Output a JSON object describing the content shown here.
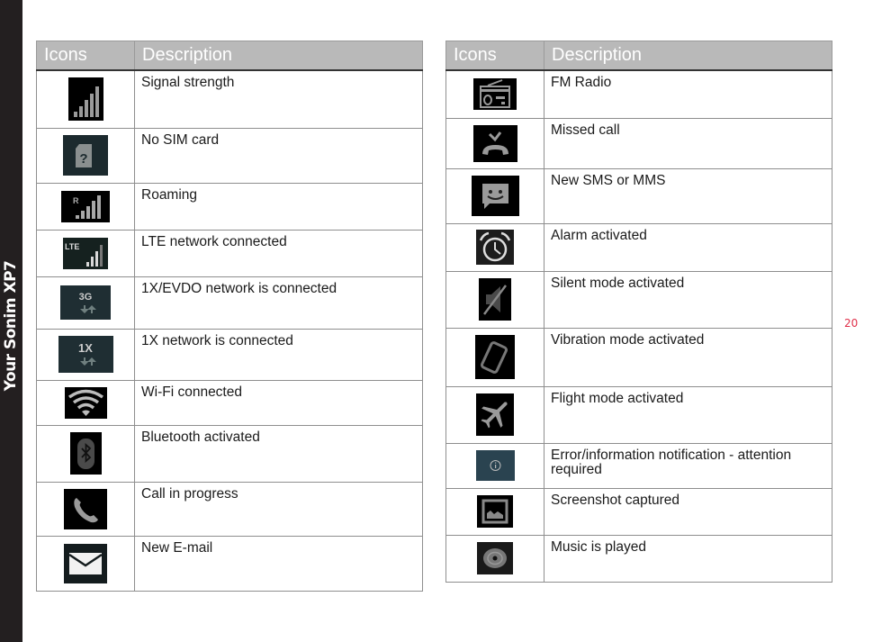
{
  "sidebar": {
    "title": "Your Sonim XP7"
  },
  "page_number": "20",
  "left_table": {
    "headers": {
      "icons": "Icons",
      "description": "Description"
    },
    "rows": [
      {
        "icon": "signal-strength-icon",
        "description": "Signal strength"
      },
      {
        "icon": "no-sim-card-icon",
        "description": "No SIM card"
      },
      {
        "icon": "roaming-icon",
        "description": "Roaming"
      },
      {
        "icon": "lte-icon",
        "description": "LTE network connected"
      },
      {
        "icon": "3g-icon",
        "description": "1X/EVDO network is connected"
      },
      {
        "icon": "1x-icon",
        "description": "1X network is connected"
      },
      {
        "icon": "wifi-icon",
        "description": "Wi-Fi connected"
      },
      {
        "icon": "bluetooth-icon",
        "description": "Bluetooth activated"
      },
      {
        "icon": "phone-call-icon",
        "description": "Call in progress"
      },
      {
        "icon": "email-icon",
        "description": "New E-mail"
      }
    ]
  },
  "right_table": {
    "headers": {
      "icons": "Icons",
      "description": "Description"
    },
    "rows": [
      {
        "icon": "fm-radio-icon",
        "description": "FM Radio"
      },
      {
        "icon": "missed-call-icon",
        "description": "Missed call"
      },
      {
        "icon": "sms-icon",
        "description": "New SMS or MMS"
      },
      {
        "icon": "alarm-icon",
        "description": "Alarm activated"
      },
      {
        "icon": "silent-mode-icon",
        "description": "Silent mode activated"
      },
      {
        "icon": "vibration-icon",
        "description": "Vibration mode activated"
      },
      {
        "icon": "airplane-icon",
        "description": "Flight mode activated"
      },
      {
        "icon": "info-icon",
        "description": "Error/information notification -  attention required"
      },
      {
        "icon": "screenshot-icon",
        "description": "Screenshot captured"
      },
      {
        "icon": "music-icon",
        "description": "Music is played"
      }
    ]
  },
  "icon_labels": {
    "roaming": "R",
    "lte": "LTE",
    "threeg": "3G",
    "onex": "1X",
    "nosim": "?"
  },
  "colors": {
    "sidebar": "#231f20",
    "header_bg": "#b9b9b9",
    "page_number": "#e0304a",
    "info_icon_bg": "#2a4350"
  }
}
